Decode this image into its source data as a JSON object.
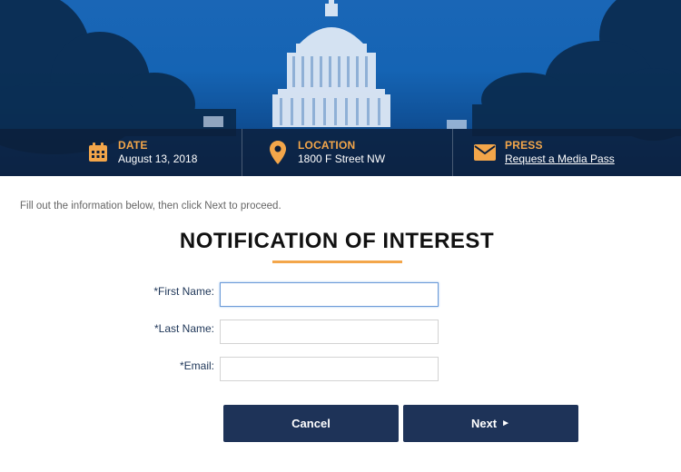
{
  "info_bar": {
    "date": {
      "label": "DATE",
      "value": "August 13, 2018",
      "icon": "calendar-icon"
    },
    "location": {
      "label": "LOCATION",
      "value": "1800 F Street NW",
      "icon": "map-pin-icon"
    },
    "press": {
      "label": "PRESS",
      "link": "Request a Media Pass",
      "icon": "envelope-icon"
    }
  },
  "form": {
    "instructions": "Fill out the information below, then click Next to proceed.",
    "title": "NOTIFICATION OF INTEREST",
    "fields": {
      "first_name": {
        "label": "*First Name:",
        "value": ""
      },
      "last_name": {
        "label": "*Last Name:",
        "value": ""
      },
      "email": {
        "label": "*Email:",
        "value": ""
      }
    },
    "buttons": {
      "cancel": "Cancel",
      "next": "Next",
      "next_arrow": "►"
    }
  },
  "colors": {
    "accent": "#f3a64a",
    "button_bg": "#1e3358",
    "hero_blue": "#1564b4"
  }
}
